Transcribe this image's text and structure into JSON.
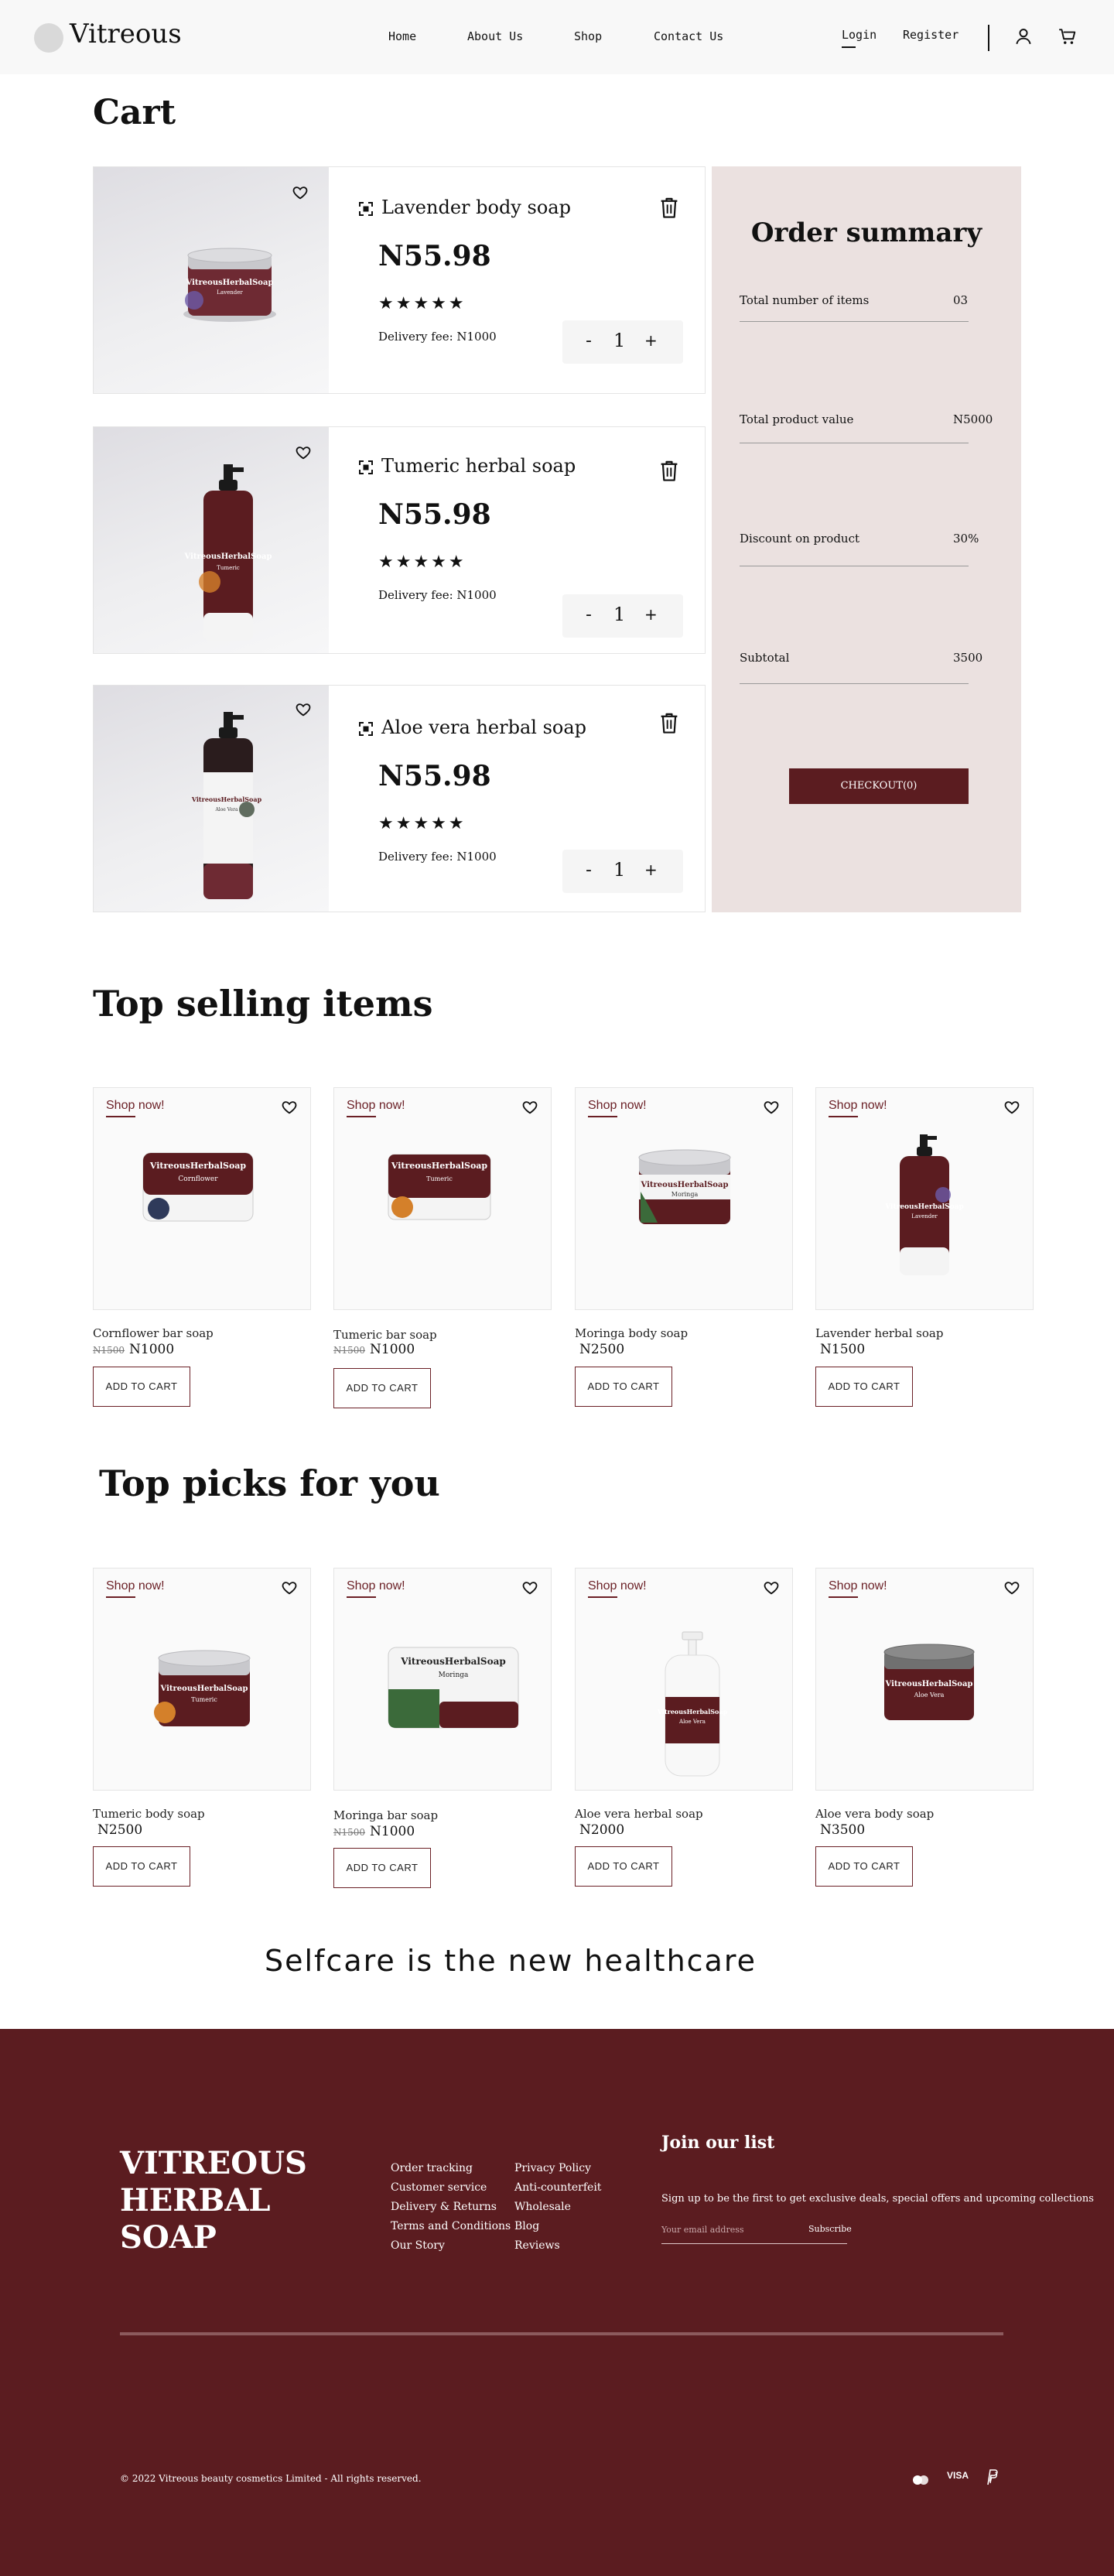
{
  "nav": {
    "brand": "Vitreous",
    "links": [
      "Home",
      "About Us",
      "Shop",
      "Contact Us"
    ],
    "login": "Login",
    "register": "Register"
  },
  "cart": {
    "title": "Cart",
    "items": [
      {
        "name": "Lavender body soap",
        "price": "N55.98",
        "stars": "★★★★★",
        "delivery": "Delivery fee: N1000",
        "qty": "1",
        "minus": "-",
        "plus": "+",
        "label_brand": "VitreousHerbalSoap",
        "label_variant": "Lavender"
      },
      {
        "name": "Tumeric herbal soap",
        "price": "N55.98",
        "stars": "★★★★★",
        "delivery": "Delivery fee: N1000",
        "qty": "1",
        "minus": "-",
        "plus": "+",
        "label_brand": "VitreousHerbalSoap",
        "label_variant": "Tumeric"
      },
      {
        "name": "Aloe vera herbal soap",
        "price": "N55.98",
        "stars": "★★★★★",
        "delivery": "Delivery fee: N1000",
        "qty": "1",
        "minus": "-",
        "plus": "+",
        "label_brand": "VitreousHerbalSoap",
        "label_variant": "Aloe Vera"
      }
    ]
  },
  "summary": {
    "title": "Order summary",
    "rows": [
      {
        "label": "Total number of items",
        "value": "03"
      },
      {
        "label": "Total product value",
        "value": "N5000"
      },
      {
        "label": "Discount on product",
        "value": "30%"
      },
      {
        "label": "Subtotal",
        "value": "3500"
      }
    ],
    "checkout": "CHECKOUT(0)"
  },
  "top_selling": {
    "title": "Top selling items",
    "shop_now": "Shop now!",
    "add_to_cart": "ADD TO CART",
    "items": [
      {
        "name": "Cornflower bar soap",
        "old_price": "N1500",
        "price": "N1000",
        "label_brand": "VitreousHerbalSoap",
        "label_variant": "Cornflower"
      },
      {
        "name": "Tumeric bar soap",
        "old_price": "N1500",
        "price": "N1000",
        "label_brand": "VitreousHerbalSoap",
        "label_variant": "Tumeric"
      },
      {
        "name": "Moringa body soap",
        "old_price": "",
        "price": "N2500",
        "label_brand": "VitreousHerbalSoap",
        "label_variant": "Moringa"
      },
      {
        "name": "Lavender herbal soap",
        "old_price": "",
        "price": "N1500",
        "label_brand": "VitreousHerbalSoap",
        "label_variant": "Lavender"
      }
    ]
  },
  "top_picks": {
    "title": "Top picks for you",
    "shop_now": "Shop now!",
    "add_to_cart": "ADD TO CART",
    "items": [
      {
        "name": "Tumeric body soap",
        "old_price": "",
        "price": "N2500",
        "label_brand": "VitreousHerbalSoap",
        "label_variant": "Tumeric"
      },
      {
        "name": "Moringa bar soap",
        "old_price": "N1500",
        "price": "N1000",
        "label_brand": "VitreousHerbalSoap",
        "label_variant": "Moringa"
      },
      {
        "name": "Aloe vera herbal soap",
        "old_price": "",
        "price": "N2000",
        "label_brand": "VitreousHerbalSoap",
        "label_variant": "Aloe Vera"
      },
      {
        "name": "Aloe vera body soap",
        "old_price": "",
        "price": "N3500",
        "label_brand": "VitreousHerbalSoap",
        "label_variant": "Aloe Vera"
      }
    ]
  },
  "tagline": "Selfcare is the new healthcare",
  "footer": {
    "brand_lines": [
      "VITREOUS",
      "HERBAL",
      "SOAP"
    ],
    "col1": [
      "Order tracking",
      "Customer service",
      "Delivery & Returns",
      "Terms and Conditions",
      "Our Story"
    ],
    "col2": [
      "Privacy Policy",
      "Anti-counterfeit",
      "Wholesale",
      "Blog",
      "Reviews"
    ],
    "join_title": "Join our list",
    "join_desc": "Sign up to be the first to get exclusive deals, special offers and upcoming collections",
    "email_placeholder": "Your email address",
    "subscribe": "Subscribe",
    "copyright": "© 2022 Vitreous beauty cosmetics Limited - All rights reserved.",
    "visa": "VISA"
  },
  "colors": {
    "brand_maroon": "#5b1c20",
    "summary_bg": "#ebe1e0",
    "navbar_bg": "#f8f8f8"
  },
  "icons": [
    "user-icon",
    "cart-icon",
    "heart-icon",
    "trash-icon",
    "focus-icon",
    "mastercard-icon",
    "paypal-icon"
  ]
}
